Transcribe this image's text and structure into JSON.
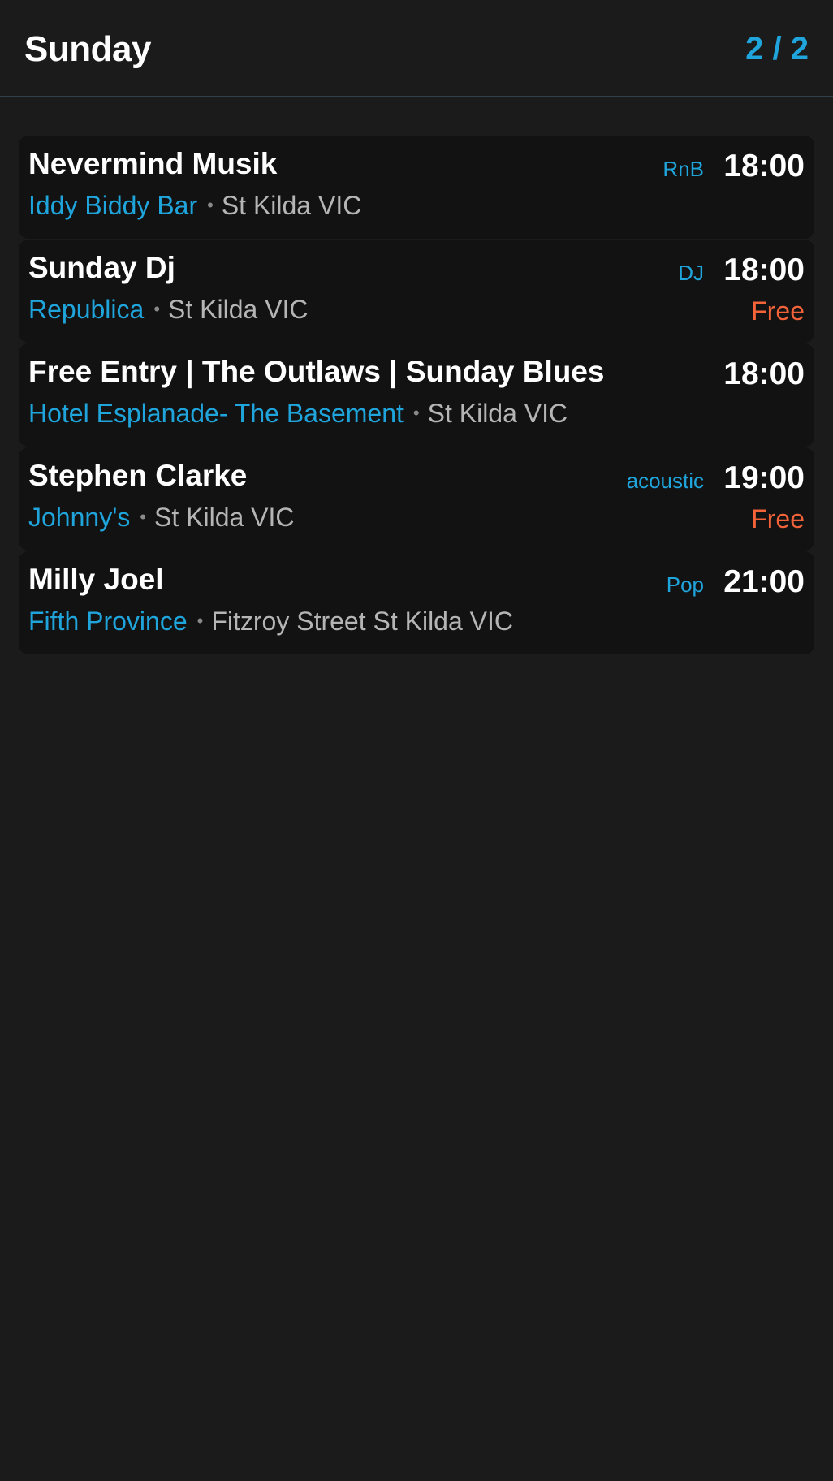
{
  "header": {
    "title": "Sunday",
    "pager": "2 / 2"
  },
  "colors": {
    "background": "#1b1b1b",
    "card": "#121212",
    "accent": "#1fa5dc",
    "price": "#f2633a"
  },
  "events": [
    {
      "name": "Nevermind Musik",
      "venue": "Iddy Biddy Bar",
      "separator": "•",
      "location": "St Kilda VIC",
      "genre": "RnB",
      "time": "18:00",
      "price": ""
    },
    {
      "name": "Sunday Dj",
      "venue": "Republica",
      "separator": "•",
      "location": "St Kilda VIC",
      "genre": "DJ",
      "time": "18:00",
      "price": "Free"
    },
    {
      "name": "Free Entry | The Outlaws | Sunday Blues",
      "venue": "Hotel Esplanade- The Basement",
      "separator": "•",
      "location": "St Kilda VIC",
      "genre": "",
      "time": "18:00",
      "price": ""
    },
    {
      "name": "Stephen Clarke",
      "venue": "Johnny's",
      "separator": "•",
      "location": "St Kilda VIC",
      "genre": "acoustic",
      "time": "19:00",
      "price": "Free"
    },
    {
      "name": "Milly Joel",
      "venue": "Fifth Province",
      "separator": "•",
      "location": "Fitzroy Street St Kilda VIC",
      "genre": "Pop",
      "time": "21:00",
      "price": ""
    }
  ]
}
